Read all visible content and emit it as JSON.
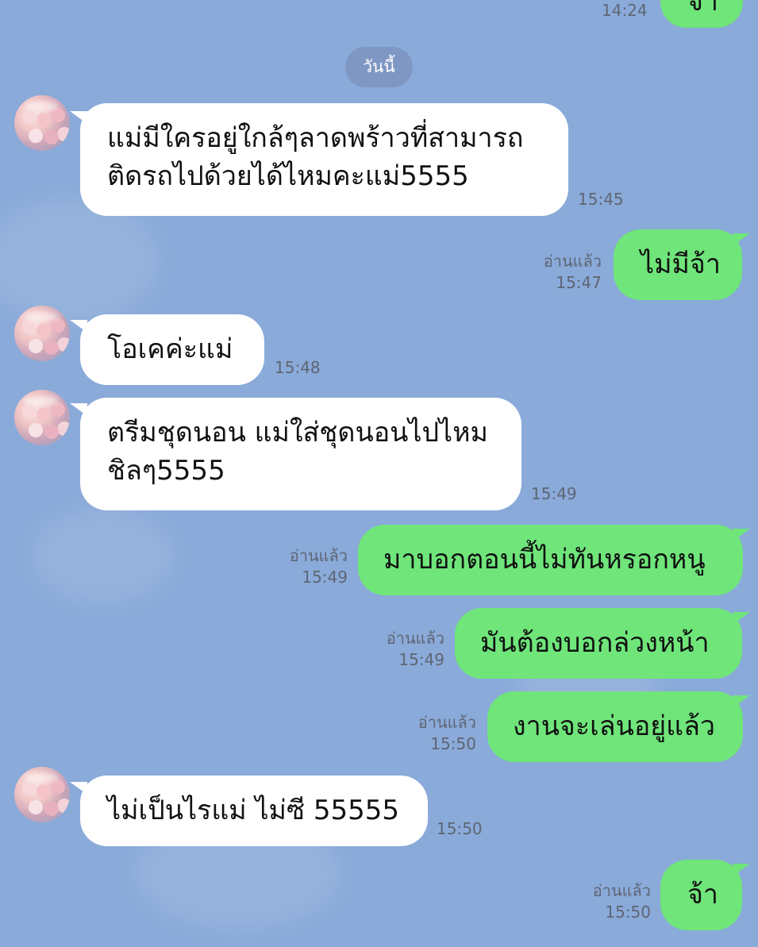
{
  "header": {
    "date_chip": "วันนี้"
  },
  "top_partial": {
    "time": "14:24",
    "bubble_text": "จ้า"
  },
  "messages": [
    {
      "from": "left",
      "lines": [
        "แม่มีใครอยู่ใกล้ๆลาดพร้าวที่สามารถ",
        "ติดรถไปด้วยได้ไหมคะแม่5555"
      ],
      "time": "15:45"
    },
    {
      "from": "right",
      "lines": [
        "ไม่มีจ้า"
      ],
      "read": "อ่านแล้ว",
      "time": "15:47"
    },
    {
      "from": "left",
      "lines": [
        "โอเคค่ะแม่"
      ],
      "time": "15:48"
    },
    {
      "from": "left",
      "lines": [
        "ตรีมชุดนอน แม่ใส่ชุดนอนไปไหม",
        "ชิลๆ5555"
      ],
      "time": "15:49"
    },
    {
      "from": "right",
      "lines": [
        "มาบอกตอนนี้ไม่ทันหรอกหนู"
      ],
      "read": "อ่านแล้ว",
      "time": "15:49"
    },
    {
      "from": "right",
      "lines": [
        "มันต้องบอกล่วงหน้า"
      ],
      "read": "อ่านแล้ว",
      "time": "15:49"
    },
    {
      "from": "right",
      "lines": [
        "งานจะเล่นอยู่แล้ว"
      ],
      "read": "อ่านแล้ว",
      "time": "15:50"
    },
    {
      "from": "left",
      "lines": [
        "ไม่เป็นไรแม่ ไม่ซี 55555"
      ],
      "time": "15:50"
    },
    {
      "from": "right",
      "lines": [
        "จ้า"
      ],
      "read": "อ่านแล้ว",
      "time": "15:50"
    }
  ],
  "colors": {
    "background": "#8aaad9",
    "outgoing_bubble": "#6fe57a",
    "incoming_bubble": "#ffffff",
    "date_chip": "#7f97c3",
    "meta_text": "#5e6674"
  }
}
